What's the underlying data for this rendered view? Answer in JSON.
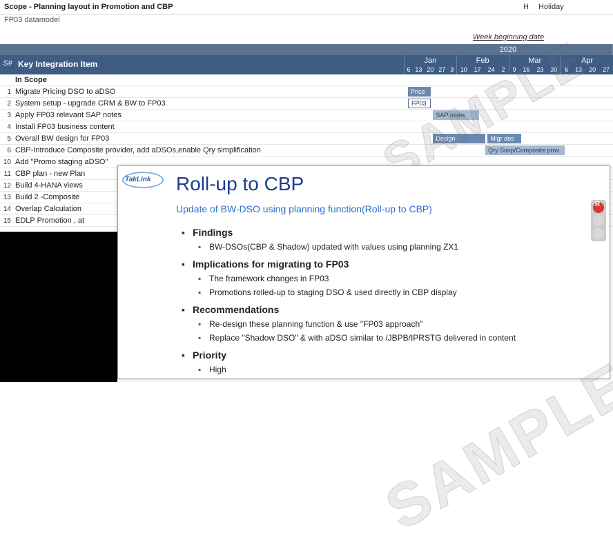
{
  "title": "Scope - Planning layout in Promotion and CBP",
  "subtitle": "FP03 datamodel",
  "holiday_key": "H",
  "holiday_label": "Holiday",
  "week_beginning": "Week beginning date",
  "year_label": "2020",
  "header": {
    "sn": "S#",
    "item": "Key Integration Item"
  },
  "months": [
    {
      "name": "Jan",
      "days": [
        "6",
        "13",
        "20",
        "27",
        "3"
      ]
    },
    {
      "name": "Feb",
      "days": [
        "10",
        "17",
        "24",
        "2"
      ]
    },
    {
      "name": "Mar",
      "days": [
        "9",
        "16",
        "23",
        "30"
      ]
    },
    {
      "name": "Apr",
      "days": [
        "6",
        "13",
        "20",
        "27"
      ]
    }
  ],
  "section_label": "In Scope",
  "rows": [
    {
      "sn": "1",
      "item": "Migrate Pricing DSO to aDSO",
      "bar": {
        "left_pct": 2,
        "width_pct": 11,
        "label": "Price",
        "cls": ""
      }
    },
    {
      "sn": "2",
      "item": "System setup - upgrade CRM & BW to FP03",
      "bar": {
        "left_pct": 2,
        "width_pct": 11,
        "label": "FP03",
        "cls": "border"
      }
    },
    {
      "sn": "3",
      "item": "Apply FP03 relevant  SAP notes",
      "bar": {
        "left_pct": 14,
        "width_pct": 22,
        "label": "SAP notes",
        "cls": "light"
      }
    },
    {
      "sn": "4",
      "item": "Install FP03 business content",
      "bar": null
    },
    {
      "sn": "5",
      "item": "Overall BW design for FP03",
      "bar": {
        "left_pct": 14,
        "width_pct": 25,
        "label": "Design",
        "cls": ""
      }
    },
    {
      "sn": "6",
      "item": "CBP-Introduce Composite provider, add aDSOs,enable Qry simplification",
      "bar": {
        "left_pct": 39,
        "width_pct": 38,
        "label": "Qry Simp/Composite prov",
        "cls": "light"
      }
    },
    {
      "sn": "10",
      "item": "Add \"Promo staging aDSO\"",
      "bar": null
    },
    {
      "sn": "11",
      "item": "CBP plan - new Plan",
      "bar": null
    },
    {
      "sn": "12",
      "item": "Build 4-HANA views",
      "bar": null
    },
    {
      "sn": "13",
      "item": "Build 2 -Composite",
      "bar": null
    },
    {
      "sn": "14",
      "item": "Overlap Calculation",
      "bar": null
    },
    {
      "sn": "15",
      "item": "EDLP Promotion , at",
      "bar": null
    }
  ],
  "row5_extra": {
    "left_pct": 40,
    "width_pct": 16,
    "label": "Migr des",
    "cls": ""
  },
  "slide": {
    "logo": "TakLink",
    "title": "Roll-up to CBP",
    "subtitle": "Update of BW-DSO using planning function(Roll-up to CBP)",
    "sections": [
      {
        "head": "Findings",
        "items": [
          "BW-DSOs(CBP & Shadow) updated with values using planning ZX1"
        ]
      },
      {
        "head": "Implications for migrating to FP03",
        "items": [
          "The framework changes in FP03",
          "Promotions rolled-up to staging DSO & used directly in CBP display"
        ]
      },
      {
        "head": "Recommendations",
        "items": [
          "Re-design these planning function & use \"FP03 approach\"",
          "Replace  \"Shadow DSO\" & with aDSO similar to /JBPB/IPRSTG delivered in content"
        ]
      },
      {
        "head": "Priority",
        "items": [
          "High"
        ]
      }
    ]
  },
  "watermark": "SAMPLE",
  "traffic_label": "R"
}
